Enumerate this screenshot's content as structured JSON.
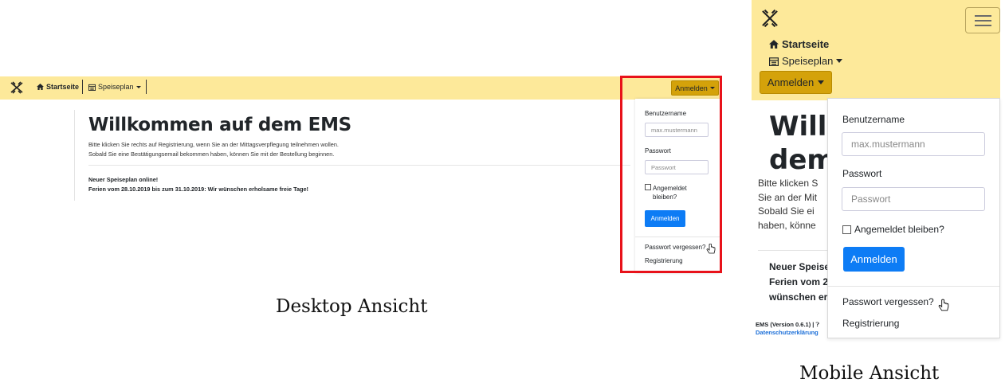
{
  "desktop": {
    "nav": {
      "home_label": "Startseite",
      "menu_label": "Speiseplan",
      "login_menu_label": "Anmelden"
    },
    "main": {
      "title": "Willkommen auf dem EMS",
      "intro_line1": "Bitte klicken Sie rechts auf Registrierung, wenn Sie an der Mittagsverpflegung teilnehmen wollen.",
      "intro_line2": "Sobald Sie eine Bestätigungsemail bekommen haben, können Sie mit der Bestellung beginnen.",
      "news_line1": "Neuer Speiseplan online!",
      "news_line2": "Ferien vom 28.10.2019 bis zum 31.10.2019: Wir wünschen erholsame freie Tage!"
    },
    "login": {
      "username_label": "Benutzername",
      "username_placeholder": "max.mustermann",
      "password_label": "Passwort",
      "password_placeholder": "Passwort",
      "remember_line1": "Angemeldet",
      "remember_line2": "bleiben?",
      "submit_label": "Anmelden",
      "forgot_label": "Passwort vergessen?",
      "register_label": "Registrierung"
    },
    "caption": "Desktop Ansicht"
  },
  "mobile": {
    "nav": {
      "home_label": "Startseite",
      "menu_label": "Speiseplan",
      "login_menu_label": "Anmelden"
    },
    "main": {
      "title_line1": "Willko",
      "title_line2": "dem",
      "text_line1": "Bitte klicken S",
      "text_line2": "Sie an der Mit",
      "text_line3": "Sobald Sie ei",
      "text_line4": "haben, könne",
      "news_line1": "Neuer Speise",
      "news_line2": "Ferien vom 2",
      "news_line3": "wünschen er",
      "footer_line1": "EMS (Version 0.6.1) |",
      "footer_link": "Datenschutzerklärung"
    },
    "login": {
      "username_label": "Benutzername",
      "username_placeholder": "max.mustermann",
      "password_label": "Passwort",
      "password_placeholder": "Passwort",
      "remember_label": "Angemeldet bleiben?",
      "submit_label": "Anmelden",
      "forgot_label": "Passwort vergessen?",
      "register_label": "Registrierung"
    },
    "caption": "Mobile Ansicht"
  },
  "colors": {
    "navbar": "#fde99a",
    "dropdown_button": "#d4a20a",
    "primary_button": "#0d7cf5",
    "highlight_box": "#e8121a"
  }
}
